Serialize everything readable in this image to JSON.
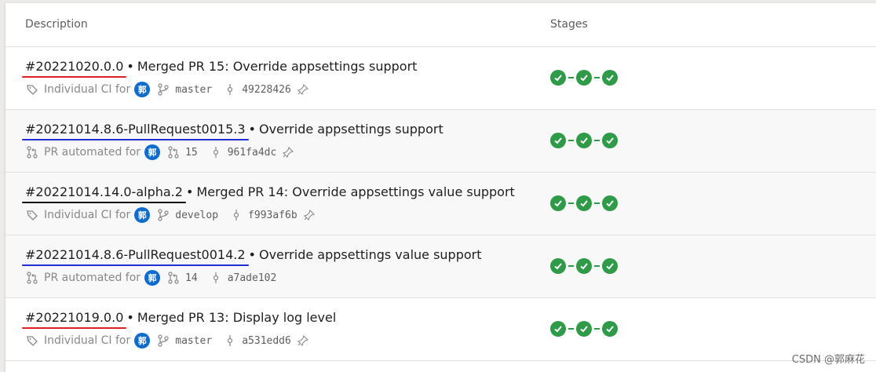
{
  "header": {
    "description": "Description",
    "stages": "Stages"
  },
  "rows": [
    {
      "build": "#20221020.0.0",
      "separator": "•",
      "title": "Merged PR 15: Override appsettings support",
      "trigger": "Individual CI for",
      "trigger_icon": "tag-icon",
      "avatar": "郭",
      "ref": "master",
      "ref_icon": "branch-icon",
      "commit": "49228426",
      "annotation_color": "#e02020",
      "stages": [
        "succeeded",
        "succeeded",
        "succeeded"
      ]
    },
    {
      "build": "#20221014.8.6-PullRequest0015.3",
      "separator": "•",
      "title": "Override appsettings support",
      "trigger": "PR automated for",
      "trigger_icon": "pull-request-icon",
      "avatar": "郭",
      "ref": "15",
      "ref_icon": "pull-request-icon",
      "commit": "961fa4dc",
      "annotation_color": "#1f2fd0",
      "stages": [
        "succeeded",
        "succeeded",
        "succeeded"
      ]
    },
    {
      "build": "#20221014.14.0-alpha.2",
      "separator": "•",
      "title": "Merged PR 14: Override appsettings value support",
      "trigger": "Individual CI for",
      "trigger_icon": "tag-icon",
      "avatar": "郭",
      "ref": "develop",
      "ref_icon": "branch-icon",
      "commit": "f993af6b",
      "annotation_color": "#111111",
      "stages": [
        "succeeded",
        "succeeded",
        "succeeded"
      ]
    },
    {
      "build": "#20221014.8.6-PullRequest0014.2",
      "separator": "•",
      "title": "Override appsettings value support",
      "trigger": "PR automated for",
      "trigger_icon": "pull-request-icon",
      "avatar": "郭",
      "ref": "14",
      "ref_icon": "pull-request-icon",
      "commit": "a7ade102",
      "annotation_color": "#1f2fd0",
      "stages": [
        "succeeded",
        "succeeded",
        "succeeded"
      ]
    },
    {
      "build": "#20221019.0.0",
      "separator": "•",
      "title": "Merged PR 13: Display log level",
      "trigger": "Individual CI for",
      "trigger_icon": "tag-icon",
      "avatar": "郭",
      "ref": "master",
      "ref_icon": "branch-icon",
      "commit": "a531edd6",
      "annotation_color": "#e02020",
      "stages": [
        "succeeded",
        "succeeded",
        "succeeded"
      ]
    }
  ],
  "watermark": "CSDN @郭麻花",
  "colors": {
    "success": "#2f9a48",
    "avatar": "#0f6ccf"
  }
}
